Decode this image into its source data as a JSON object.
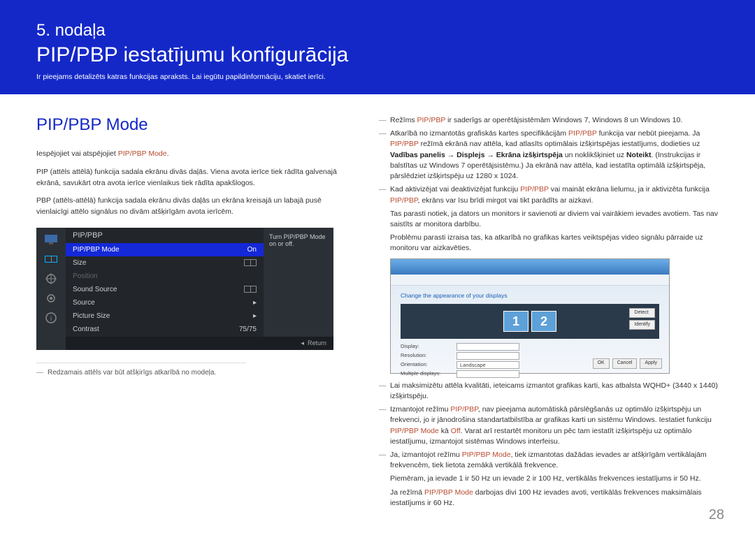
{
  "page_number": "28",
  "header": {
    "chapter": "5. nodaļa",
    "title": "PIP/PBP iestatījumu konfigurācija",
    "subtitle": "Ir pieejams detalizēts katras funkcijas apraksts. Lai iegūtu papildinformāciju, skatiet ierīci."
  },
  "left": {
    "section_title": "PIP/PBP Mode",
    "p1_pre": "Iespējojiet vai atspējojiet ",
    "p1_hl": "PIP/PBP Mode",
    "p1_post": ".",
    "p2": "PIP (attēls attēlā) funkcija sadala ekrānu divās daļās. Viena avota ierīce tiek rādīta galvenajā ekrānā, savukārt otra avota ierīce vienlaikus tiek rādīta apakšlogos.",
    "p3": "PBP (attēls-attēlā) funkcija sadala ekrānu divās daļās un ekrāna kreisajā un labajā pusē vienlaicīgi attēlo signālus no divām atšķirīgām avota ierīcēm.",
    "footnote": "Redzamais attēls var būt atšķirīgs atkarībā no modeļa."
  },
  "osd": {
    "header": "PIP/PBP",
    "tip": "Turn PIP/PBP Mode on or off.",
    "rows": {
      "mode_label": "PIP/PBP Mode",
      "mode_value": "On",
      "size_label": "Size",
      "position_label": "Position",
      "sound_label": "Sound Source",
      "source_label": "Source",
      "picsize_label": "Picture Size",
      "contrast_label": "Contrast",
      "contrast_value": "75/75"
    },
    "footer_return": "Return"
  },
  "right": {
    "n1_pre": "Režīms ",
    "n1_hl": "PIP/PBP",
    "n1_post": " ir saderīgs ar operētājsistēmām Windows 7, Windows 8 un Windows 10.",
    "n2_pre": "Atkarībā no izmantotās grafiskās kartes specifikācijām ",
    "n2_hl1": "PIP/PBP",
    "n2_mid1": " funkcija var nebūt pieejama. Ja ",
    "n2_hl2": "PIP/PBP",
    "n2_mid2": " režīmā ekrānā nav attēla, kad atlasīts optimālais izšķirtspējas iestatījums, dodieties uz ",
    "n2_b1": "Vadības panelis",
    "n2_arrow1": " → ",
    "n2_b2": "Displejs",
    "n2_arrow2": " → ",
    "n2_b3": "Ekrāna izšķirtspēja",
    "n2_mid3": " un noklikšķiniet uz ",
    "n2_b4": "Noteikt",
    "n2_post": ". (Instrukcijas ir balstītas uz Windows 7 operētājsistēmu.) Ja ekrānā nav attēla, kad iestatīta optimālā izšķirtspēja, pārslēdziet izšķirtspēju uz 1280 x 1024.",
    "n3_pre": "Kad aktivizējat vai deaktivizējat funkciju ",
    "n3_hl1": "PIP/PBP",
    "n3_mid": " vai maināt ekrāna lielumu, ja ir aktivizēta funkcija ",
    "n3_hl2": "PIP/PBP",
    "n3_post": ", ekrāns var īsu brīdi mirgot vai tikt parādīts ar aizkavi.",
    "n3_sub1": "Tas parasti notiek, ja dators un monitors ir savienoti ar diviem vai vairākiem ievades avotiem. Tas nav saistīts ar monitora darbību.",
    "n3_sub2": "Problēmu parasti izraisa tas, ka atkarībā no grafikas kartes veiktspējas video signālu pārraide uz monitoru var aizkavēties.",
    "n4": "Lai maksimizētu attēla kvalitāti, ieteicams izmantot grafikas karti, kas atbalsta WQHD+ (3440 x 1440) izšķirtspēju.",
    "n5_pre": "Izmantojot režīmu ",
    "n5_hl1": "PIP/PBP",
    "n5_mid1": ", nav pieejama automātiskā pārslēgšanās uz optimālo izšķirtspēju un frekvenci, jo ir jānodrošina standartatbilstība ar grafikas karti un sistēmu Windows. Iestatiet funkciju ",
    "n5_hl2": "PIP/PBP Mode",
    "n5_mid2": " kā ",
    "n5_hl3": "Off",
    "n5_post": ". Varat arī restartēt monitoru un pēc tam iestatīt izšķirtspēju uz optimālo iestatījumu, izmantojot sistēmas Windows interfeisu.",
    "n6_pre": "Ja, izmantojot režīmu ",
    "n6_hl": "PIP/PBP Mode",
    "n6_post": ", tiek izmantotas dažādas ievades ar atšķirīgām vertikālajām frekvencēm, tiek lietota zemākā vertikālā frekvence.",
    "n6_sub1": "Piemēram, ja ievade 1 ir 50 Hz un ievade 2 ir 100 Hz, vertikālās frekvences iestatījums ir 50 Hz.",
    "n6_sub2_pre": "Ja režīmā ",
    "n6_sub2_hl": "PIP/PBP Mode",
    "n6_sub2_post": " darbojas divi 100 Hz ievades avoti, vertikālās frekvences maksimālais iestatījums ir 60 Hz."
  },
  "win": {
    "link": "Change the appearance of your displays",
    "mon1": "1",
    "mon2": "2",
    "btn_detect": "Detect",
    "btn_identify": "Identify",
    "lbl_display": "Display:",
    "lbl_res": "Resolution:",
    "lbl_orient": "Orientation:",
    "lbl_multi": "Multiple displays:",
    "val_orient": "Landscape",
    "btn_ok": "OK",
    "btn_cancel": "Cancel",
    "btn_apply": "Apply"
  }
}
